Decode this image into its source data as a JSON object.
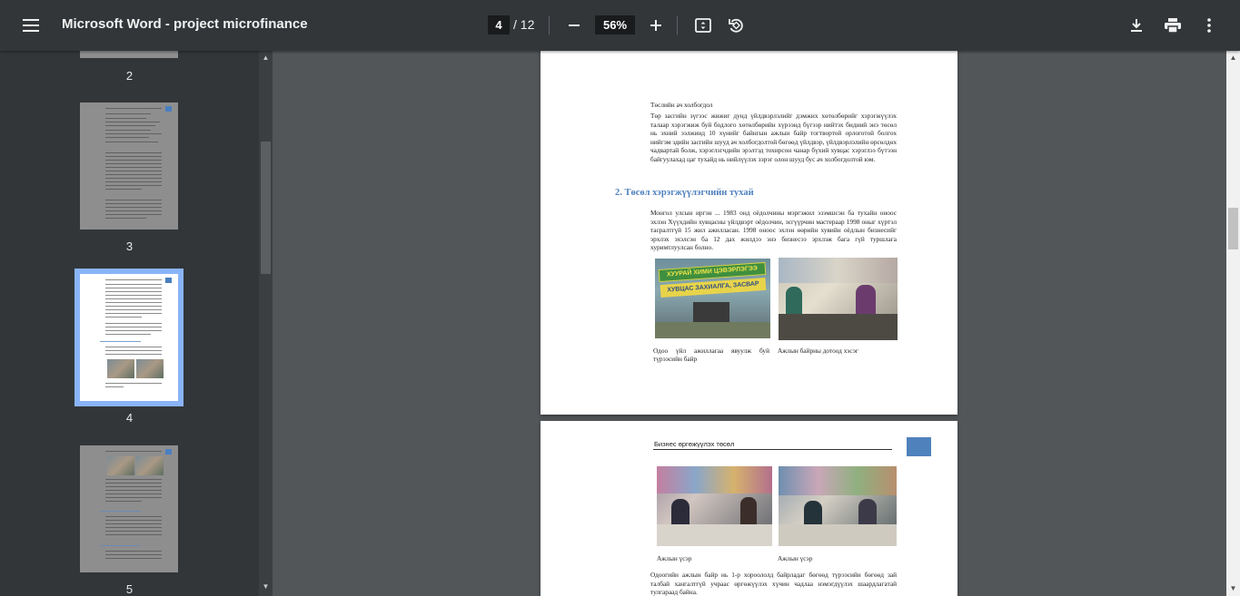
{
  "toolbar": {
    "title": "Microsoft Word - project microfinance",
    "current_page": "4",
    "total_pages": "/ 12",
    "zoom": "56%"
  },
  "sidebar": {
    "thumbnails": [
      {
        "label": "2"
      },
      {
        "label": "3"
      },
      {
        "label": "4",
        "selected": true
      },
      {
        "label": "5"
      }
    ]
  },
  "document": {
    "page4": {
      "top_line": "Төслийн ач холбогдол",
      "paragraph1": "Төр засгийн зүгээс жижиг дунд үйлдвэрлэлийг дэмжих хөтөлбөрийг хэрэгжүүлэх талаар хэрэгжиж буй бодлого хөтөлбөрийн хүрээнд бүгээр нийтэх бидний энэ төсөл нь эхний ээлжинд 10 хүнийг байнгын ажлын байр тогтвортой орлоготой болгох нийгэм эдийн засгийн шууд ач холбогдолтой бөгөөд үйлдвэр, үйлдвэрлэлийн өрсөлдөх чадвартай болж, хэрэглэгчдийн эрэлтэд тохирсон чанар бүхий хувцас хэрэглээ бүтээн байгуулахад цаг тухайд нь нийлүүлэх зэрэг олон шууд бус ач холбогдолтой юм.",
      "heading": "2. Төсөл хэрэгжүүлэгчийн тухай",
      "paragraph2": "Монгол улсын иргэн ... 1983 онд оёдолчины мэргэжил эзэмшсэн ба тухайн оноос эхлэн Хүүхдийн хувцасны үйлдвэрт оёдолчин, эсгүүрчин мастераар 1998 оныг хүртэл тасралтгүй 15 жил ажилласан. 1998 оноос эхлэн өөрийн хувийн оёдлын бизнесийг эрхлэх эхэлсэн ба 12 дах жилдээ энэ бизнесээ эрхлэж бага гүй туршлага хуримтлуулсан болно.",
      "caption1": "Одоо үйл ажиллагаа явуулж буй түрээсийн байр",
      "caption2": "Ажлын байрны дотоод хэсэг",
      "sign1": "ХУУРАЙ ХИМИ ЦЭВЭРЛЭГЭЭ",
      "sign2": "ХУВЦАС ЗАХИАЛГА, ЗАСВАР"
    },
    "page5": {
      "header": "Бизнес өргөжүүлэх төсөл",
      "caption1": "Ажлын үсэр",
      "caption2": "Ажлын үсэр",
      "paragraph": "Одоогийн ажлын байр нь 1-р хороололд байрладаг бөгөөд түрээсийн бөгөөд зай талбай хангалтгүй учраас өргөжүүлэх хүчин чадлаа нэмэгдүүлэх шаардлагатай тулгараад байна."
    }
  },
  "icons": {
    "menu": "hamburger-menu-icon",
    "zoom_out": "minus-icon",
    "zoom_in": "plus-icon",
    "fit": "fit-to-page-icon",
    "rotate": "rotate-icon",
    "download": "download-icon",
    "print": "printer-icon",
    "more": "more-vertical-icon"
  },
  "colors": {
    "toolbar_bg": "#323639",
    "viewer_bg": "#525659",
    "selected_outline": "#8ab4f8",
    "heading_blue": "#4f81bd"
  }
}
